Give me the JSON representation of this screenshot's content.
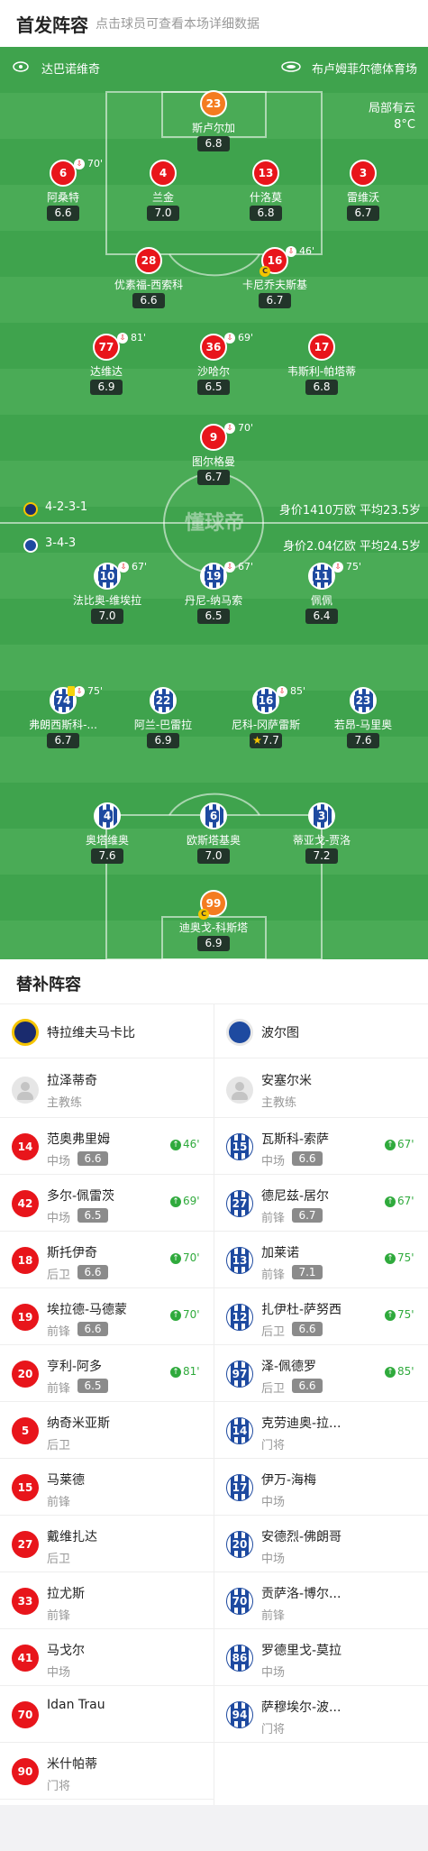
{
  "header": {
    "title": "首发阵容",
    "hint": "点击球员可查看本场详细数据"
  },
  "pitch": {
    "home_team": "达巴诺维奇",
    "venue": "布卢姆菲尔德体育场",
    "weather": [
      "局部有云",
      "8°C"
    ],
    "watermark": "懂球帝",
    "home_formation": "4-2-3-1",
    "home_value": "身价1410万欧  平均23.5岁",
    "away_formation": "3-4-3",
    "away_value": "身价2.04亿欧  平均24.5岁"
  },
  "home_players": [
    {
      "num": "23",
      "name": "斯卢尔加",
      "rating": "6.8",
      "gk": true
    },
    {
      "num": "6",
      "name": "阿桑特",
      "rating": "6.6",
      "sub": "70'"
    },
    {
      "num": "4",
      "name": "兰金",
      "rating": "7.0"
    },
    {
      "num": "13",
      "name": "什洛莫",
      "rating": "6.8"
    },
    {
      "num": "3",
      "name": "雷维沃",
      "rating": "6.7"
    },
    {
      "num": "28",
      "name": "优素福-西索科",
      "rating": "6.6"
    },
    {
      "num": "16",
      "name": "卡尼乔夫斯基",
      "rating": "6.7",
      "sub": "46'",
      "captain": true
    },
    {
      "num": "77",
      "name": "达维达",
      "rating": "6.9",
      "sub": "81'"
    },
    {
      "num": "36",
      "name": "沙哈尔",
      "rating": "6.5",
      "sub": "69'"
    },
    {
      "num": "17",
      "name": "韦斯利-帕塔蒂",
      "rating": "6.8"
    },
    {
      "num": "9",
      "name": "图尔格曼",
      "rating": "6.7",
      "sub": "70'"
    }
  ],
  "away_players": [
    {
      "num": "10",
      "name": "法比奥-维埃拉",
      "rating": "7.0",
      "sub": "67'"
    },
    {
      "num": "19",
      "name": "丹尼-纳马索",
      "rating": "6.5",
      "sub": "67'"
    },
    {
      "num": "11",
      "name": "佩佩",
      "rating": "6.4",
      "sub": "75'"
    },
    {
      "num": "74",
      "name": "弗朗西斯科-...",
      "rating": "6.7",
      "sub": "75'",
      "yellow": true
    },
    {
      "num": "22",
      "name": "阿兰-巴雷拉",
      "rating": "6.9"
    },
    {
      "num": "16",
      "name": "尼科-冈萨雷斯",
      "rating": "7.7",
      "sub": "85'",
      "star": true
    },
    {
      "num": "23",
      "name": "若昂-马里奥",
      "rating": "7.6"
    },
    {
      "num": "4",
      "name": "奥塔维奥",
      "rating": "7.6"
    },
    {
      "num": "6",
      "name": "欧斯塔基奥",
      "rating": "7.0"
    },
    {
      "num": "3",
      "name": "蒂亚戈-贾洛",
      "rating": "7.2"
    },
    {
      "num": "99",
      "name": "迪奥戈-科斯塔",
      "rating": "6.9",
      "gk": true,
      "captain": true
    }
  ],
  "subs": {
    "title": "替补阵容",
    "home_team": "特拉维夫马卡比",
    "away_team": "波尔图",
    "home_coach": {
      "name": "拉泽蒂奇",
      "role": "主教练"
    },
    "away_coach": {
      "name": "安塞尔米",
      "role": "主教练"
    },
    "home": [
      {
        "num": "14",
        "name": "范奥弗里姆",
        "pos": "中场",
        "rating": "6.6",
        "in": "46'"
      },
      {
        "num": "42",
        "name": "多尔-佩雷茨",
        "pos": "中场",
        "rating": "6.5",
        "in": "69'"
      },
      {
        "num": "18",
        "name": "斯托伊奇",
        "pos": "后卫",
        "rating": "6.6",
        "in": "70'"
      },
      {
        "num": "19",
        "name": "埃拉德-马德蒙",
        "pos": "前锋",
        "rating": "6.6",
        "in": "70'"
      },
      {
        "num": "20",
        "name": "亨利-阿多",
        "pos": "前锋",
        "rating": "6.5",
        "in": "81'"
      },
      {
        "num": "5",
        "name": "纳奇米亚斯",
        "pos": "后卫"
      },
      {
        "num": "15",
        "name": "马莱德",
        "pos": "前锋"
      },
      {
        "num": "27",
        "name": "戴维扎达",
        "pos": "后卫"
      },
      {
        "num": "33",
        "name": "拉尤斯",
        "pos": "前锋"
      },
      {
        "num": "41",
        "name": "马戈尔",
        "pos": "中场"
      },
      {
        "num": "70",
        "name": "Idan Trau",
        "pos": ""
      },
      {
        "num": "90",
        "name": "米什帕蒂",
        "pos": "门将"
      }
    ],
    "away": [
      {
        "num": "15",
        "name": "瓦斯科-索萨",
        "pos": "中场",
        "rating": "6.6",
        "in": "67'"
      },
      {
        "num": "27",
        "name": "德尼兹-居尔",
        "pos": "前锋",
        "rating": "6.7",
        "in": "67'"
      },
      {
        "num": "13",
        "name": "加莱诺",
        "pos": "前锋",
        "rating": "7.1",
        "in": "75'"
      },
      {
        "num": "12",
        "name": "扎伊杜-萨努西",
        "pos": "后卫",
        "rating": "6.6",
        "in": "75'"
      },
      {
        "num": "97",
        "name": "泽-佩德罗",
        "pos": "后卫",
        "rating": "6.6",
        "in": "85'"
      },
      {
        "num": "14",
        "name": "克劳迪奥-拉...",
        "pos": "门将"
      },
      {
        "num": "17",
        "name": "伊万-海梅",
        "pos": "中场"
      },
      {
        "num": "20",
        "name": "安德烈-佛朗哥",
        "pos": "中场"
      },
      {
        "num": "70",
        "name": "贡萨洛-博尔...",
        "pos": "前锋"
      },
      {
        "num": "86",
        "name": "罗德里戈-莫拉",
        "pos": "中场"
      },
      {
        "num": "94",
        "name": "萨穆埃尔-波...",
        "pos": "门将"
      }
    ]
  },
  "colors": {
    "home_red": "#e8151b",
    "gk_orange": "#f47c20",
    "porto_blue": "#1e4aa0",
    "pitch_green": "#3fa34d",
    "sub_green": "#2faa3c"
  }
}
